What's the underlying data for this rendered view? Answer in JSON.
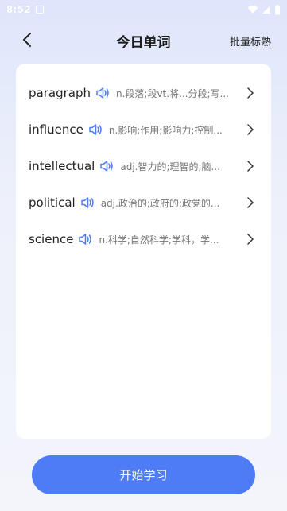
{
  "status_bar": {
    "time": "8:52"
  },
  "header": {
    "title": "今日单词",
    "batch_action": "批量标熟"
  },
  "words": [
    {
      "word": "paragraph",
      "meaning": "n.段落;段vt.将...分段;写..."
    },
    {
      "word": "influence",
      "meaning": "n.影响;作用;影响力;控制..."
    },
    {
      "word": "intellectual",
      "meaning": "adj.智力的;理智的;脑..."
    },
    {
      "word": "political",
      "meaning": "adj.政治的;政府的;政党的..."
    },
    {
      "word": "science",
      "meaning": "n.科学;自然科学;学科，学..."
    }
  ],
  "start_button": "开始学习",
  "colors": {
    "accent": "#4d7cf6",
    "speaker": "#4d7cf6"
  },
  "icons": {
    "back": "chevron-left-icon",
    "speaker": "speaker-icon",
    "arrow": "chevron-right-icon"
  }
}
